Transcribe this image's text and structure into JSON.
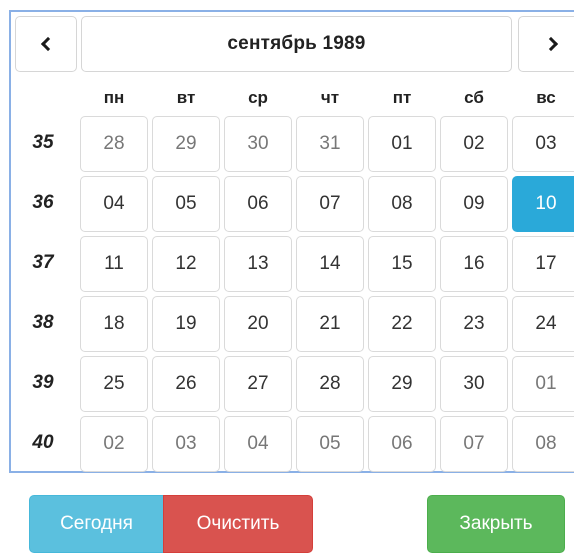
{
  "calendar": {
    "title": "сентябрь 1989",
    "prev_icon": "chevron-left-icon",
    "next_icon": "chevron-right-icon",
    "weekdays": [
      "пн",
      "вт",
      "ср",
      "чт",
      "пт",
      "сб",
      "вс"
    ],
    "weeks": [
      {
        "number": "35",
        "days": [
          {
            "label": "28",
            "muted": true
          },
          {
            "label": "29",
            "muted": true
          },
          {
            "label": "30",
            "muted": true
          },
          {
            "label": "31",
            "muted": true
          },
          {
            "label": "01"
          },
          {
            "label": "02"
          },
          {
            "label": "03"
          }
        ]
      },
      {
        "number": "36",
        "days": [
          {
            "label": "04"
          },
          {
            "label": "05"
          },
          {
            "label": "06"
          },
          {
            "label": "07"
          },
          {
            "label": "08"
          },
          {
            "label": "09"
          },
          {
            "label": "10",
            "selected": true
          }
        ]
      },
      {
        "number": "37",
        "days": [
          {
            "label": "11"
          },
          {
            "label": "12"
          },
          {
            "label": "13"
          },
          {
            "label": "14"
          },
          {
            "label": "15"
          },
          {
            "label": "16"
          },
          {
            "label": "17"
          }
        ]
      },
      {
        "number": "38",
        "days": [
          {
            "label": "18"
          },
          {
            "label": "19"
          },
          {
            "label": "20"
          },
          {
            "label": "21"
          },
          {
            "label": "22"
          },
          {
            "label": "23"
          },
          {
            "label": "24"
          }
        ]
      },
      {
        "number": "39",
        "days": [
          {
            "label": "25"
          },
          {
            "label": "26"
          },
          {
            "label": "27"
          },
          {
            "label": "28"
          },
          {
            "label": "29"
          },
          {
            "label": "30"
          },
          {
            "label": "01",
            "muted": true
          }
        ]
      },
      {
        "number": "40",
        "days": [
          {
            "label": "02",
            "muted": true
          },
          {
            "label": "03",
            "muted": true
          },
          {
            "label": "04",
            "muted": true
          },
          {
            "label": "05",
            "muted": true
          },
          {
            "label": "06",
            "muted": true
          },
          {
            "label": "07",
            "muted": true
          },
          {
            "label": "08",
            "muted": true
          }
        ]
      }
    ]
  },
  "buttons": {
    "today": "Сегодня",
    "clear": "Очистить",
    "close": "Закрыть"
  },
  "colors": {
    "selected": "#2aa9d9",
    "today": "#5bc0de",
    "clear": "#d9534f",
    "close": "#5cb85c",
    "border_accent": "#8ab0e6"
  }
}
